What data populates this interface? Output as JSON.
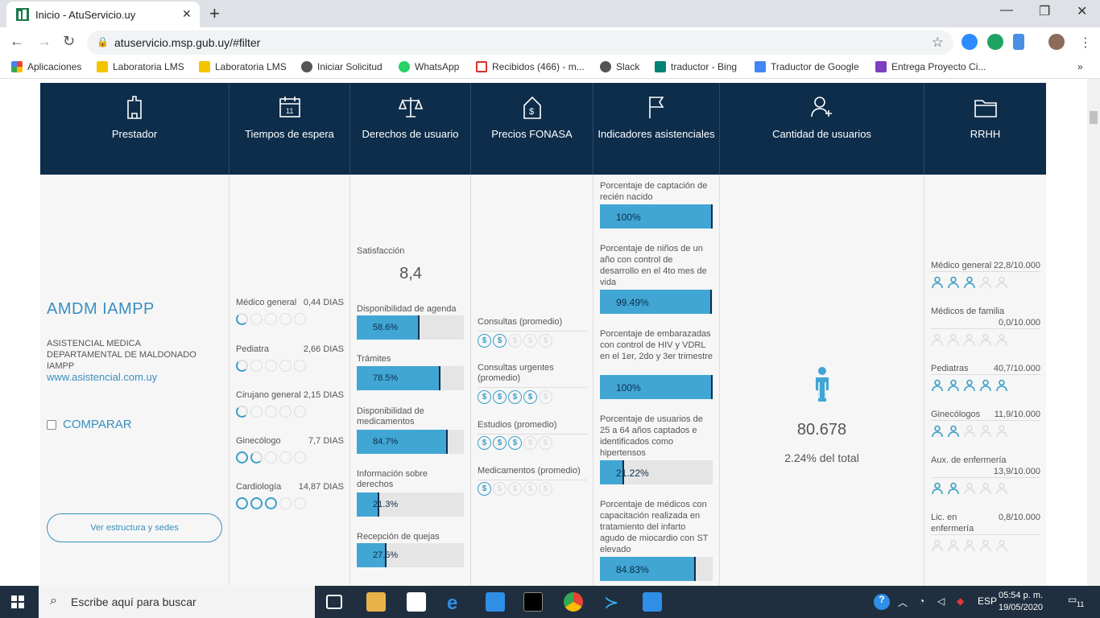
{
  "browser": {
    "tab_title": "Inicio - AtuServicio.uy",
    "url": "atuservicio.msp.gub.uy/#filter",
    "bookmarks": [
      "Aplicaciones",
      "Laboratoria LMS",
      "Laboratoria LMS",
      "Iniciar Solicitud",
      "WhatsApp",
      "Recibidos (466) - m...",
      "Slack",
      "traductor - Bing",
      "Traductor de Google",
      "Entrega Proyecto Ci..."
    ],
    "bookmarks_more": "»"
  },
  "header": {
    "cols": [
      "Prestador",
      "Tiempos de espera",
      "Derechos de usuario",
      "Precios FONASA",
      "Indicadores asistenciales",
      "Cantidad de usuarios",
      "RRHH"
    ],
    "accent": "#0d2d4a"
  },
  "provider": {
    "name": "AMDM IAMPP",
    "full_name": "ASISTENCIAL MEDICA DEPARTAMENTAL DE MALDONADO IAMPP",
    "website": "www.asistencial.com.uy",
    "compare_label": "COMPARAR",
    "structure_button": "Ver estructura y sedes"
  },
  "wait_times": [
    {
      "label": "Médico general",
      "value": "0,44 DIAS",
      "level": 0.5
    },
    {
      "label": "Pediatra",
      "value": "2,66 DIAS",
      "level": 0.5
    },
    {
      "label": "Cirujano general",
      "value": "2,15 DIAS",
      "level": 0.5
    },
    {
      "label": "Ginecólogo",
      "value": "7,7 DIAS",
      "level": 1.5
    },
    {
      "label": "Cardiología",
      "value": "14,87 DIAS",
      "level": 3
    }
  ],
  "rights": {
    "satisfaction_label": "Satisfacción",
    "satisfaction_value": "8,4",
    "bars": [
      {
        "label": "Disponibilidad de agenda",
        "value": "58.6%",
        "pct": 58.6
      },
      {
        "label": "Trámites",
        "value": "78.5%",
        "pct": 78.5
      },
      {
        "label": "Disponibilidad de medicamentos",
        "value": "84.7%",
        "pct": 84.7
      },
      {
        "label": "Información sobre derechos",
        "value": "21.3%",
        "pct": 21.3
      },
      {
        "label": "Recepción de quejas",
        "value": "27.5%",
        "pct": 27.5
      }
    ]
  },
  "fonasa": [
    {
      "label": "Consultas (promedio)",
      "level": 1.5
    },
    {
      "label": "Consultas urgentes (promedio)",
      "level": 4
    },
    {
      "label": "Estudios (promedio)",
      "level": 3
    },
    {
      "label": "Medicamentos (promedio)",
      "level": 1
    }
  ],
  "coin_symbol": "$",
  "indicators": [
    {
      "label": "Porcentaje de captación de recién nacido",
      "value": "100%",
      "pct": 100
    },
    {
      "label": "Porcentaje de niños de un año con control de desarrollo en el 4to mes de vida",
      "value": "99.49%",
      "pct": 99.49
    },
    {
      "label": "Porcentaje de embarazadas con control de HIV y VDRL en el 1er, 2do y 3er trimestre",
      "value": "100%",
      "pct": 100
    },
    {
      "label": "Porcentaje de usuarios de 25 a 64 años captados e identificados como hipertensos",
      "value": "21.22%",
      "pct": 21.22
    },
    {
      "label": "Porcentaje de médicos con capacitación realizada en tratamiento del infarto agudo de miocardio con ST elevado",
      "value": "84.83%",
      "pct": 84.83
    }
  ],
  "users": {
    "count": "80.678",
    "share": "2.24% del total"
  },
  "rrhh": [
    {
      "label": "Médico general",
      "value": "22,8/10.000",
      "level": 2.5
    },
    {
      "label": "Médicos de familia",
      "value": "0,0/10.000",
      "level": 0
    },
    {
      "label": "Pediatras",
      "value": "40,7/10.000",
      "level": 4.5
    },
    {
      "label": "Ginecólogos",
      "value": "11,9/10.000",
      "level": 1.5
    },
    {
      "label": "Aux. de enfermería",
      "value": "13,9/10.000",
      "level": 1.5
    },
    {
      "label": "Lic. en enfermería",
      "value": "0,8/10.000",
      "level": 0
    }
  ],
  "taskbar": {
    "search_placeholder": "Escribe aquí para buscar",
    "lang": "ESP",
    "time": "05:54 p. m.",
    "date": "19/05/2020",
    "notif_count": "11"
  }
}
